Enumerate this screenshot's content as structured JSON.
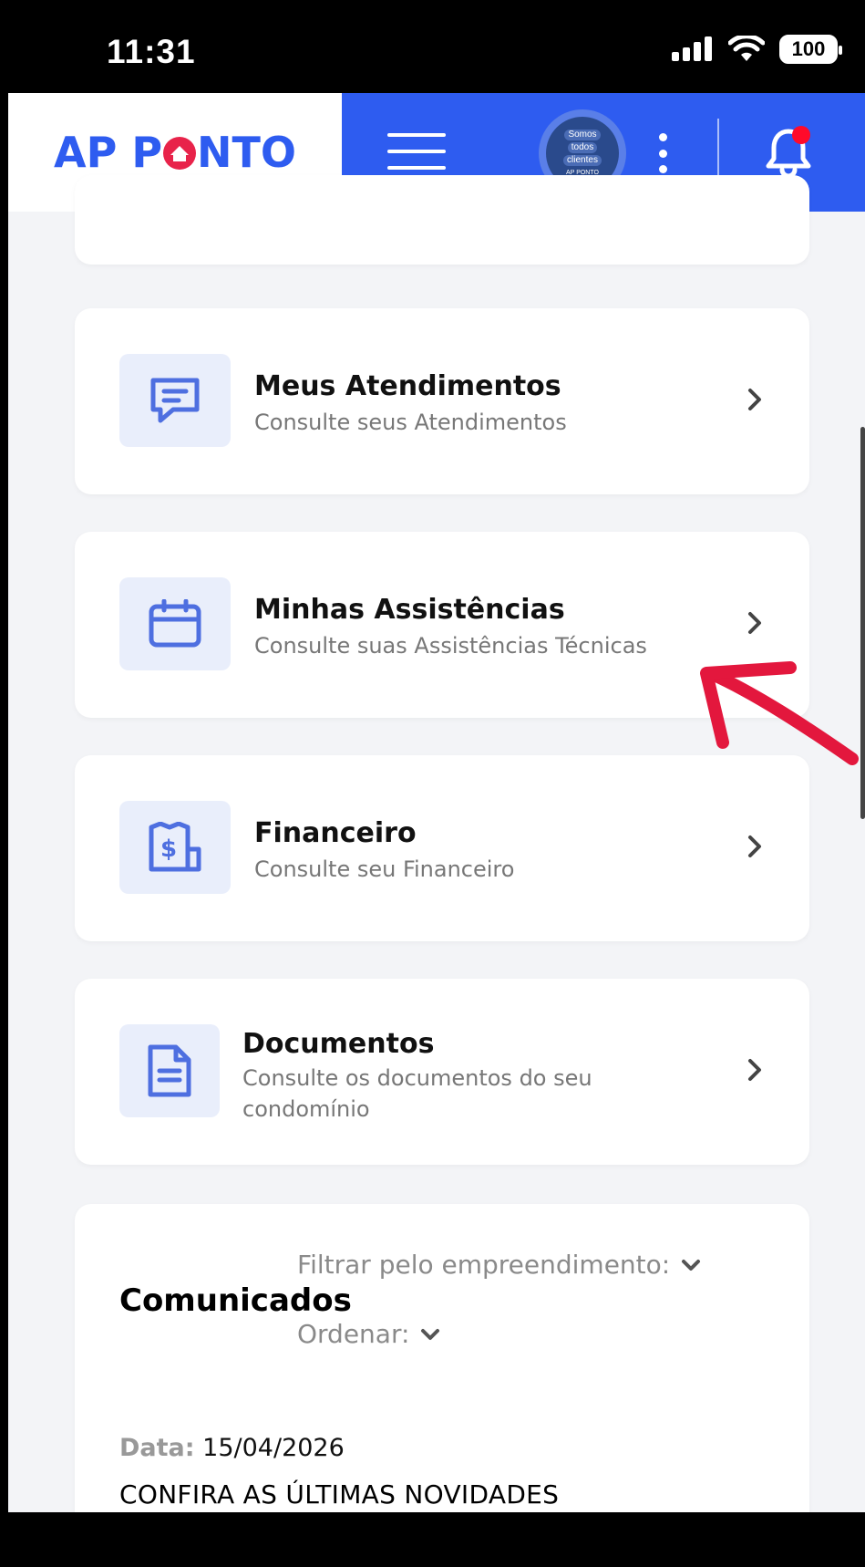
{
  "status_bar": {
    "time": "11:31",
    "battery": "100"
  },
  "header": {
    "logo": {
      "part1": "AP P",
      "part2": "NTO"
    },
    "avatar_text": [
      "Somos",
      "todos",
      "clientes",
      "AP PONTO"
    ]
  },
  "menu": [
    {
      "title": "Meus Atendimentos",
      "subtitle": "Consulte seus Atendimentos",
      "icon": "chat-icon"
    },
    {
      "title": "Minhas Assistências",
      "subtitle": "Consulte suas Assistências Técnicas",
      "icon": "calendar-icon"
    },
    {
      "title": "Financeiro",
      "subtitle": "Consulte seu Financeiro",
      "icon": "receipt-dollar-icon"
    },
    {
      "title": "Documentos",
      "subtitle": "Consulte os documentos do seu condomínio",
      "icon": "document-icon"
    }
  ],
  "comunicados": {
    "filter_label": "Filtrar pelo empreendimento:",
    "title": "Comunicados",
    "sort_label": "Ordenar:",
    "date_label": "Data:",
    "date_value": "15/04/2026",
    "headline": "CONFIRA AS ÚLTIMAS NOVIDADES"
  },
  "colors": {
    "brand_blue": "#2e5cf0",
    "brand_red": "#e8234a",
    "annotation_arrow": "#e3173d"
  }
}
